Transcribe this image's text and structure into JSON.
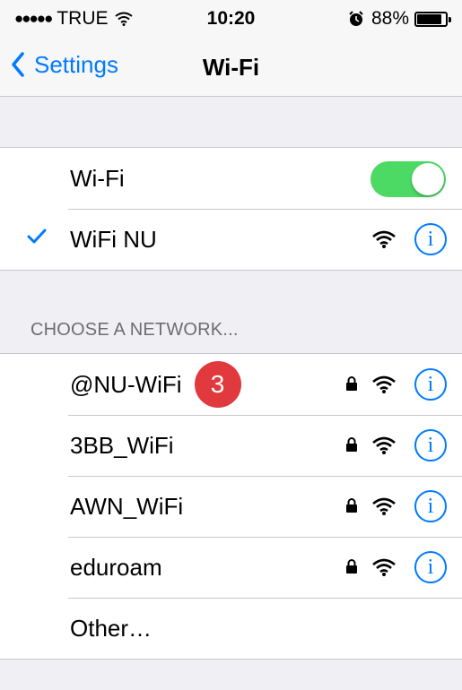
{
  "status_bar": {
    "signal_dots": "●●●●●",
    "carrier": "TRUE",
    "time": "10:20",
    "battery_percent": "88%",
    "battery_level": 0.88
  },
  "nav": {
    "back_label": "Settings",
    "title": "Wi-Fi"
  },
  "wifi_toggle": {
    "label": "Wi-Fi",
    "on": true
  },
  "connected_network": {
    "name": "WiFi NU",
    "info_label": "i"
  },
  "choose_section": {
    "header": "CHOOSE A NETWORK...",
    "networks": [
      {
        "name": "@NU-WiFi",
        "badge": "3",
        "locked": true,
        "info_label": "i"
      },
      {
        "name": "3BB_WiFi",
        "locked": true,
        "info_label": "i"
      },
      {
        "name": "AWN_WiFi",
        "locked": true,
        "info_label": "i"
      },
      {
        "name": "eduroam",
        "locked": true,
        "info_label": "i"
      }
    ],
    "other_label": "Other…"
  },
  "colors": {
    "accent": "#007aff",
    "toggle_on": "#4cd964",
    "badge": "#e0393e",
    "background": "#efeff4"
  }
}
